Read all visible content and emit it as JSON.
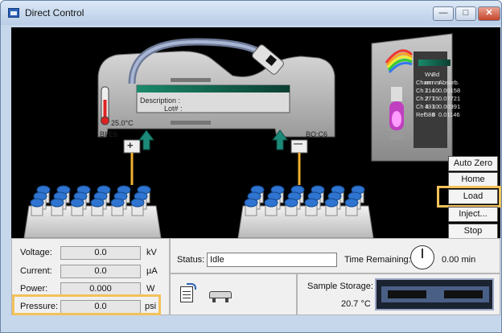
{
  "window": {
    "title": "Direct Control",
    "minimize_glyph": "—",
    "maximize_glyph": "□",
    "close_glyph": "✕"
  },
  "instrument": {
    "description_label": "Description :",
    "lot_label": "Lot# :",
    "temperature": "25.0°C",
    "inlet_label": "BI:E6",
    "outlet_label": "BO:C6",
    "plus_symbol": "+",
    "minus_symbol": "—"
  },
  "detector": {
    "header_top": [
      "",
      "Wv",
      "Bd",
      ""
    ],
    "header": [
      "Chan",
      "nm",
      "nm",
      "Absorb."
    ],
    "rows": [
      [
        "Ch 1",
        "214",
        "10",
        "0.00158"
      ],
      [
        "Ch 2",
        "277",
        "15",
        "0.07721"
      ],
      [
        "Ch 3",
        "433",
        "10",
        "0.00391"
      ],
      [
        "Ref",
        "588",
        "8",
        "0.01146"
      ]
    ]
  },
  "side_buttons": {
    "auto_zero": "Auto Zero",
    "home": "Home",
    "load": "Load",
    "inject": "Inject...",
    "stop": "Stop"
  },
  "readings": {
    "voltage": {
      "label": "Voltage:",
      "value": "0.0",
      "unit": "kV"
    },
    "current": {
      "label": "Current:",
      "value": "0.0",
      "unit": "µA"
    },
    "power": {
      "label": "Power:",
      "value": "0.000",
      "unit": "W"
    },
    "pressure": {
      "label": "Pressure:",
      "value": "0.0",
      "unit": "psi"
    }
  },
  "status": {
    "label": "Status:",
    "value": "Idle",
    "time_label": "Time Remaining:",
    "time_value": "0.00 min"
  },
  "storage": {
    "label": "Sample Storage:",
    "temperature": "20.7 °C"
  },
  "colors": {
    "highlight": "#f2c25a",
    "vial_cap": "#2f74d0",
    "teal_arrow": "#1c8a78",
    "lcd": "#0e5e4a"
  },
  "icons": [
    "window-icon",
    "edit-method-icon",
    "cartridge-icon",
    "clock-icon",
    "thermometer-icon",
    "rainbow-icon",
    "lamp-icon"
  ]
}
